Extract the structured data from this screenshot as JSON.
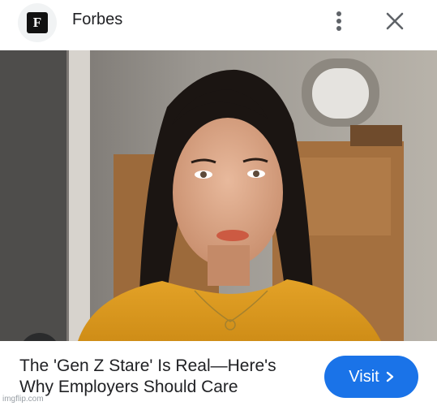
{
  "header": {
    "logo_letter": "F",
    "site_name": "Forbes",
    "more_icon": "more-vert-icon",
    "close_icon": "close-icon"
  },
  "image": {
    "lens_icon": "google-lens-icon"
  },
  "article": {
    "title_line1": "The 'Gen Z Stare' Is Real—Here's",
    "title_line2": "Why Employers Should Care"
  },
  "cta": {
    "label": "Visit",
    "icon": "chevron-right-icon",
    "color": "#1a73e8"
  },
  "watermark": "imgflip.com"
}
